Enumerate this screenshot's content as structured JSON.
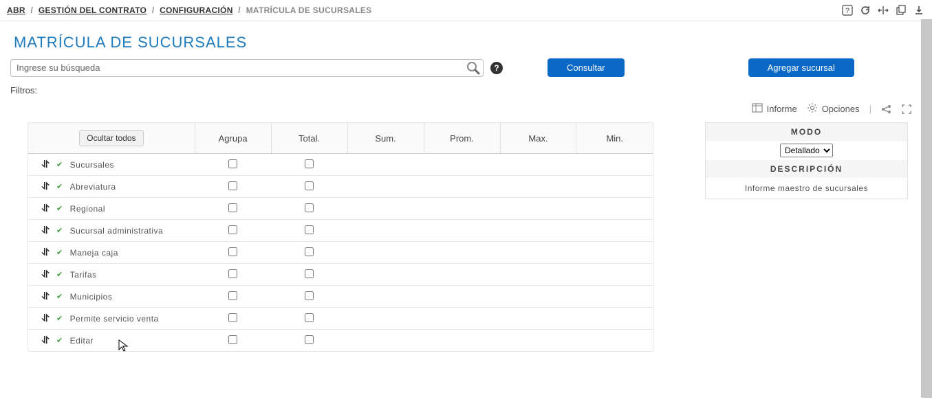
{
  "breadcrumb": {
    "items": [
      "ABR",
      "GESTIÓN DEL CONTRATO",
      "CONFIGURACIÓN",
      "MATRÍCULA DE SUCURSALES"
    ]
  },
  "page_title": "MATRÍCULA DE SUCURSALES",
  "search": {
    "placeholder": "Ingrese su búsqueda",
    "value": ""
  },
  "buttons": {
    "consult": "Consultar",
    "add_branch": "Agregar sucursal",
    "hide_all": "Ocultar todos"
  },
  "filters_label": "Filtros:",
  "tools": {
    "report": "Informe",
    "options": "Opciones"
  },
  "table": {
    "headers": {
      "name": "",
      "agrupa": "Agrupa",
      "total": "Total.",
      "sum": "Sum.",
      "prom": "Prom.",
      "max": "Max.",
      "min": "Min."
    },
    "rows": [
      {
        "label": "Sucursales"
      },
      {
        "label": "Abreviatura"
      },
      {
        "label": "Regional"
      },
      {
        "label": "Sucursal administrativa"
      },
      {
        "label": "Maneja caja"
      },
      {
        "label": "Tarifas"
      },
      {
        "label": "Municipios"
      },
      {
        "label": "Permite servicio venta"
      },
      {
        "label": "Editar"
      }
    ]
  },
  "side": {
    "mode_label": "MODO",
    "mode_selected": "Detallado",
    "mode_options": [
      "Detallado"
    ],
    "desc_label": "DESCRIPCIÓN",
    "desc_text": "Informe maestro de sucursales"
  }
}
